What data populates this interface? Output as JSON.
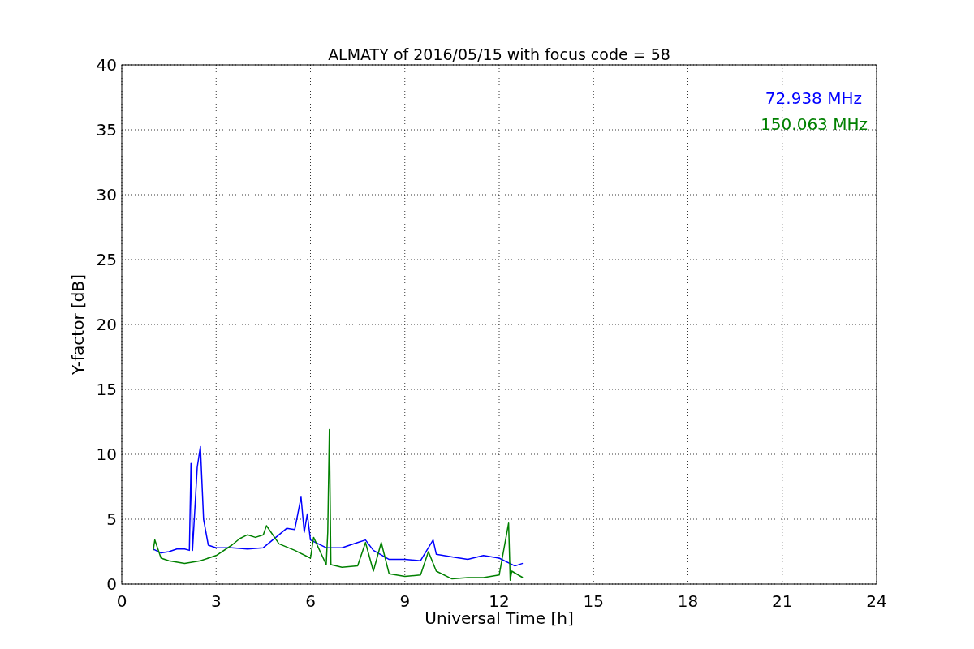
{
  "chart_data": {
    "type": "line",
    "title": "ALMATY of 2016/05/15 with focus code = 58",
    "xlabel": "Universal Time [h]",
    "ylabel": "Y-factor [dB]",
    "xlim": [
      0,
      24
    ],
    "ylim": [
      0,
      40
    ],
    "grid": true,
    "xticks": [
      0,
      3,
      6,
      9,
      12,
      15,
      18,
      21,
      24
    ],
    "yticks": [
      0,
      5,
      10,
      15,
      20,
      25,
      30,
      35,
      40
    ],
    "series": [
      {
        "name": "72.938 MHz",
        "color": "#0000ff",
        "x": [
          1.0,
          1.25,
          1.5,
          1.75,
          2.0,
          2.15,
          2.2,
          2.25,
          2.4,
          2.5,
          2.6,
          2.75,
          3.0,
          3.5,
          4.0,
          4.5,
          5.0,
          5.25,
          5.5,
          5.7,
          5.8,
          5.9,
          6.0,
          6.5,
          7.0,
          7.5,
          7.75,
          8.0,
          8.5,
          9.0,
          9.5,
          9.9,
          10.0,
          10.5,
          11.0,
          11.5,
          12.0,
          12.5,
          12.75
        ],
        "values": [
          2.7,
          2.4,
          2.5,
          2.7,
          2.7,
          2.6,
          9.3,
          2.6,
          9.0,
          10.6,
          5.0,
          3.0,
          2.8,
          2.8,
          2.7,
          2.8,
          3.8,
          4.3,
          4.2,
          6.7,
          4.0,
          5.4,
          3.4,
          2.8,
          2.8,
          3.2,
          3.4,
          2.6,
          1.9,
          1.9,
          1.8,
          3.4,
          2.3,
          2.1,
          1.9,
          2.2,
          2.0,
          1.4,
          1.6
        ]
      },
      {
        "name": "150.063 MHz",
        "color": "#008000",
        "x": [
          1.0,
          1.05,
          1.25,
          1.5,
          2.0,
          2.5,
          3.0,
          3.5,
          3.75,
          4.0,
          4.25,
          4.5,
          4.6,
          5.0,
          5.5,
          6.0,
          6.1,
          6.5,
          6.55,
          6.6,
          6.65,
          7.0,
          7.5,
          7.75,
          8.0,
          8.25,
          8.5,
          9.0,
          9.5,
          9.75,
          10.0,
          10.5,
          11.0,
          11.5,
          12.0,
          12.3,
          12.35,
          12.4,
          12.75
        ],
        "values": [
          2.6,
          3.4,
          2.0,
          1.8,
          1.6,
          1.8,
          2.2,
          3.0,
          3.5,
          3.8,
          3.6,
          3.8,
          4.5,
          3.1,
          2.6,
          2.0,
          3.6,
          1.5,
          4.0,
          11.9,
          1.5,
          1.3,
          1.4,
          3.2,
          1.0,
          3.2,
          0.8,
          0.6,
          0.7,
          2.5,
          1.0,
          0.4,
          0.5,
          0.5,
          0.7,
          4.7,
          0.3,
          1.0,
          0.5
        ]
      }
    ]
  }
}
